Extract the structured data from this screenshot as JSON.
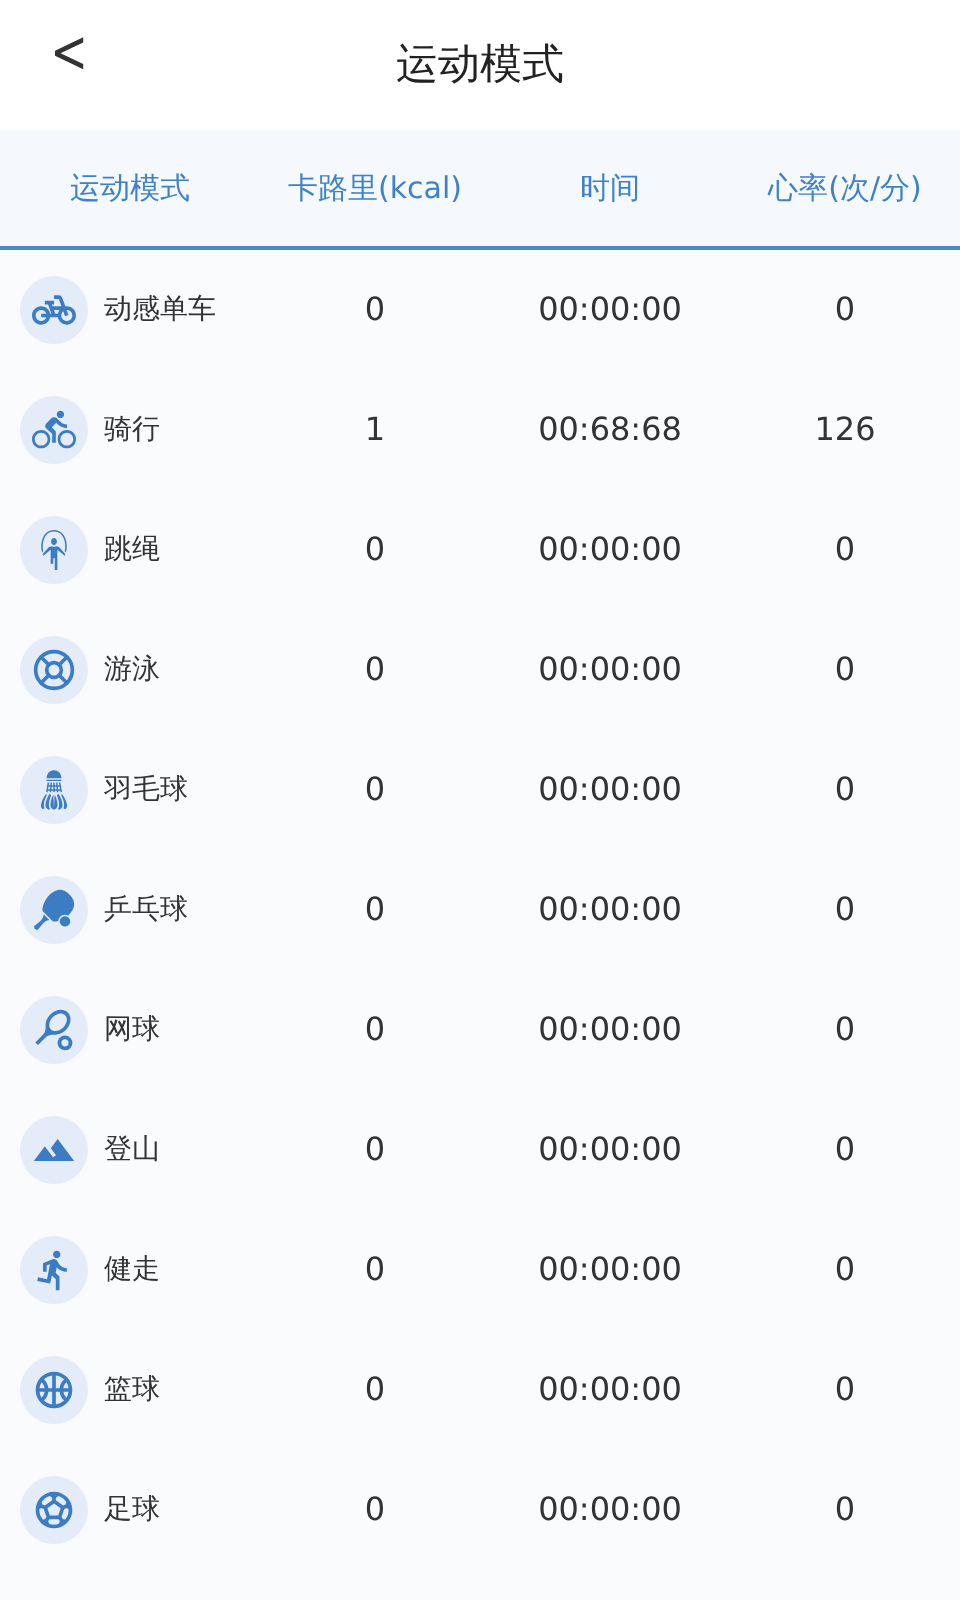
{
  "header": {
    "back": "<",
    "title": "运动模式"
  },
  "table": {
    "columns": [
      "运动模式",
      "卡路里(kcal)",
      "时间",
      "心率(次/分)"
    ],
    "rows": [
      {
        "mode": "动感单车",
        "calories": "0",
        "time": "00:00:00",
        "heart_rate": "0"
      },
      {
        "mode": "骑行",
        "calories": "1",
        "time": "00:68:68",
        "heart_rate": "126"
      },
      {
        "mode": "跳绳",
        "calories": "0",
        "time": "00:00:00",
        "heart_rate": "0"
      },
      {
        "mode": "游泳",
        "calories": "0",
        "time": "00:00:00",
        "heart_rate": "0"
      },
      {
        "mode": "羽毛球",
        "calories": "0",
        "time": "00:00:00",
        "heart_rate": "0"
      },
      {
        "mode": "乒乓球",
        "calories": "0",
        "time": "00:00:00",
        "heart_rate": "0"
      },
      {
        "mode": "网球",
        "calories": "0",
        "time": "00:00:00",
        "heart_rate": "0"
      },
      {
        "mode": "登山",
        "calories": "0",
        "time": "00:00:00",
        "heart_rate": "0"
      },
      {
        "mode": "健走",
        "calories": "0",
        "time": "00:00:00",
        "heart_rate": "0"
      },
      {
        "mode": "篮球",
        "calories": "0",
        "time": "00:00:00",
        "heart_rate": "0"
      },
      {
        "mode": "足球",
        "calories": "0",
        "time": "00:00:00",
        "heart_rate": "0"
      }
    ]
  }
}
